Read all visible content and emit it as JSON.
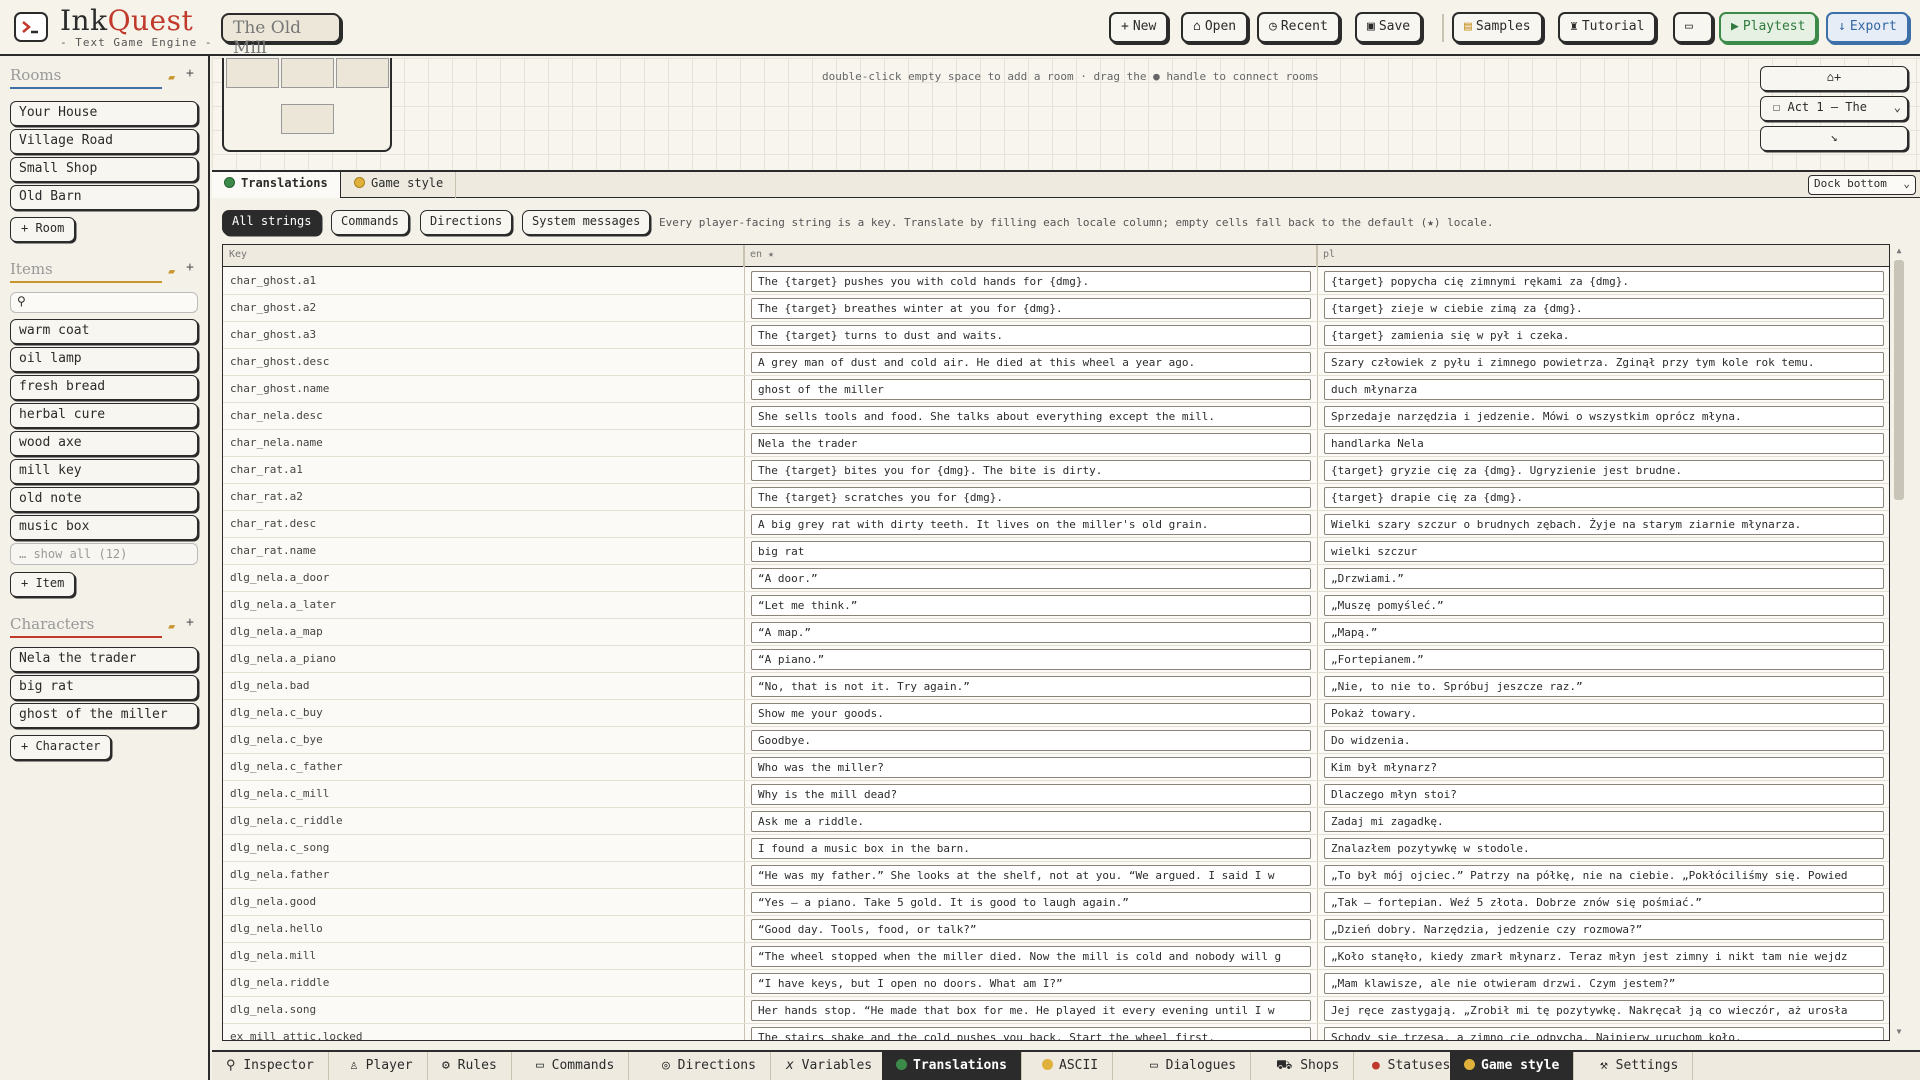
{
  "app": {
    "name_part1": "Ink",
    "name_part2": "Quest",
    "subtitle": "- Text Game Engine -",
    "project_name": "The Old Mill"
  },
  "toolbar": {
    "new": "New",
    "open": "Open",
    "recent": "Recent",
    "save": "Save",
    "samples": "Samples",
    "tutorial": "Tutorial",
    "playtest": "Playtest",
    "export": "Export"
  },
  "sidebar": {
    "rooms_title": "Rooms",
    "rooms": [
      "Your House",
      "Village Road",
      "Small Shop",
      "Old Barn"
    ],
    "add_room": "+ Room",
    "items_title": "Items",
    "items": [
      "warm coat",
      "oil lamp",
      "fresh bread",
      "herbal cure",
      "wood axe",
      "mill key",
      "old note",
      "music box"
    ],
    "show_all": "… show all (12)",
    "add_item": "+ Item",
    "characters_title": "Characters",
    "characters": [
      "Nela the trader",
      "big rat",
      "ghost of the miller"
    ],
    "add_character": "+ Character"
  },
  "map": {
    "hint": "double-click empty space to add a room · drag the ● handle to connect rooms",
    "act_select": "Act 1 — The"
  },
  "panel_tabs": {
    "translations": "Translations",
    "game_style": "Game style",
    "dock": "Dock bottom"
  },
  "filters": {
    "all": "All strings",
    "commands": "Commands",
    "directions": "Directions",
    "system": "System messages",
    "hint": "Every player-facing string is a key. Translate by filling each locale column; empty cells fall back to the default (★) locale."
  },
  "table": {
    "headers": {
      "key": "Key",
      "en": "en ★",
      "pl": "pl"
    },
    "rows": [
      {
        "key": "char_ghost.a1",
        "en": "The {target} pushes you with cold hands for {dmg}.",
        "pl": "{target} popycha cię zimnymi rękami za {dmg}."
      },
      {
        "key": "char_ghost.a2",
        "en": "The {target} breathes winter at you for {dmg}.",
        "pl": "{target} zieje w ciebie zimą za {dmg}."
      },
      {
        "key": "char_ghost.a3",
        "en": "The {target} turns to dust and waits.",
        "pl": "{target} zamienia się w pył i czeka."
      },
      {
        "key": "char_ghost.desc",
        "en": "A grey man of dust and cold air. He died at this wheel a year ago.",
        "pl": "Szary człowiek z pyłu i zimnego powietrza. Zginął przy tym kole rok temu."
      },
      {
        "key": "char_ghost.name",
        "en": "ghost of the miller",
        "pl": "duch młynarza"
      },
      {
        "key": "char_nela.desc",
        "en": "She sells tools and food. She talks about everything except the mill.",
        "pl": "Sprzedaje narzędzia i jedzenie. Mówi o wszystkim oprócz młyna."
      },
      {
        "key": "char_nela.name",
        "en": "Nela the trader",
        "pl": "handlarka Nela"
      },
      {
        "key": "char_rat.a1",
        "en": "The {target} bites you for {dmg}. The bite is dirty.",
        "pl": "{target} gryzie cię za {dmg}. Ugryzienie jest brudne."
      },
      {
        "key": "char_rat.a2",
        "en": "The {target} scratches you for {dmg}.",
        "pl": "{target} drapie cię za {dmg}."
      },
      {
        "key": "char_rat.desc",
        "en": "A big grey rat with dirty teeth. It lives on the miller's old grain.",
        "pl": "Wielki szary szczur o brudnych zębach. Żyje na starym ziarnie młynarza."
      },
      {
        "key": "char_rat.name",
        "en": "big rat",
        "pl": "wielki szczur"
      },
      {
        "key": "dlg_nela.a_door",
        "en": "“A door.”",
        "pl": "„Drzwiami.”"
      },
      {
        "key": "dlg_nela.a_later",
        "en": "“Let me think.”",
        "pl": "„Muszę pomyśleć.”"
      },
      {
        "key": "dlg_nela.a_map",
        "en": "“A map.”",
        "pl": "„Mapą.”"
      },
      {
        "key": "dlg_nela.a_piano",
        "en": "“A piano.”",
        "pl": "„Fortepianem.”"
      },
      {
        "key": "dlg_nela.bad",
        "en": "“No, that is not it. Try again.”",
        "pl": "„Nie, to nie to. Spróbuj jeszcze raz.”"
      },
      {
        "key": "dlg_nela.c_buy",
        "en": "Show me your goods.",
        "pl": "Pokaż towary."
      },
      {
        "key": "dlg_nela.c_bye",
        "en": "Goodbye.",
        "pl": "Do widzenia."
      },
      {
        "key": "dlg_nela.c_father",
        "en": "Who was the miller?",
        "pl": "Kim był młynarz?"
      },
      {
        "key": "dlg_nela.c_mill",
        "en": "Why is the mill dead?",
        "pl": "Dlaczego młyn stoi?"
      },
      {
        "key": "dlg_nela.c_riddle",
        "en": "Ask me a riddle.",
        "pl": "Zadaj mi zagadkę."
      },
      {
        "key": "dlg_nela.c_song",
        "en": "I found a music box in the barn.",
        "pl": "Znalazłem pozytywkę w stodole."
      },
      {
        "key": "dlg_nela.father",
        "en": "“He was my father.” She looks at the shelf, not at you. “We argued. I said I w",
        "pl": "„To był mój ojciec.” Patrzy na półkę, nie na ciebie. „Pokłóciliśmy się. Powied"
      },
      {
        "key": "dlg_nela.good",
        "en": "“Yes — a piano. Take 5 gold. It is good to laugh again.”",
        "pl": "„Tak — fortepian. Weź 5 złota. Dobrze znów się pośmiać.”"
      },
      {
        "key": "dlg_nela.hello",
        "en": "“Good day. Tools, food, or talk?”",
        "pl": "„Dzień dobry. Narzędzia, jedzenie czy rozmowa?”"
      },
      {
        "key": "dlg_nela.mill",
        "en": "“The wheel stopped when the miller died. Now the mill is cold and nobody will g",
        "pl": "„Koło stanęło, kiedy zmarł młynarz. Teraz młyn jest zimny i nikt tam nie wejdz"
      },
      {
        "key": "dlg_nela.riddle",
        "en": "“I have keys, but I open no doors. What am I?”",
        "pl": "„Mam klawisze, ale nie otwieram drzwi. Czym jestem?”"
      },
      {
        "key": "dlg_nela.song",
        "en": "Her hands stop. “He made that box for me. He played it every evening until I w",
        "pl": "Jej ręce zastygają. „Zrobił mi tę pozytywkę. Nakręcał ją co wieczór, aż urosła"
      },
      {
        "key": "ex_mill_attic.locked",
        "en": "The stairs shake and the cold pushes you back. Start the wheel first.",
        "pl": "Schody się trzęsą, a zimno cię odpycha. Najpierw uruchom koło."
      }
    ]
  },
  "bottom_tabs": [
    "Inspector",
    "Player",
    "Rules",
    "Commands",
    "Directions",
    "Variables",
    "Translations",
    "ASCII",
    "Dialogues",
    "Shops",
    "Statuses",
    "Game style",
    "Settings"
  ]
}
